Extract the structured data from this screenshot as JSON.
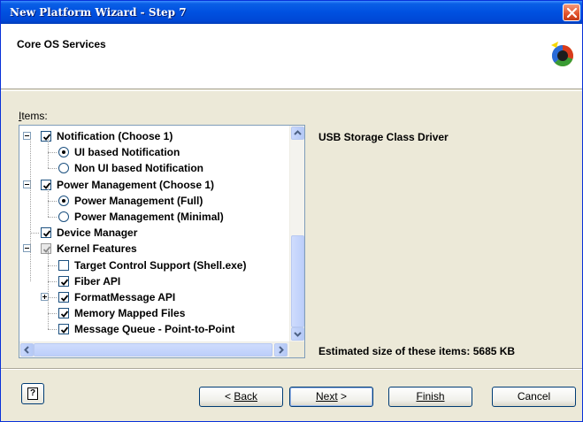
{
  "window": {
    "title": "New Platform Wizard - Step 7"
  },
  "header": {
    "page_title": "Core OS Services"
  },
  "items_label": "Items:",
  "tree": {
    "items": [
      {
        "label": "Notification (Choose 1)",
        "control": "checkbox",
        "checked": true,
        "expander": "minus"
      },
      {
        "label": "UI based Notification",
        "control": "radio",
        "selected": true
      },
      {
        "label": "Non UI based Notification",
        "control": "radio",
        "selected": false
      },
      {
        "label": "Power Management (Choose 1)",
        "control": "checkbox",
        "checked": true,
        "expander": "minus"
      },
      {
        "label": "Power Management (Full)",
        "control": "radio",
        "selected": true
      },
      {
        "label": "Power Management (Minimal)",
        "control": "radio",
        "selected": false
      },
      {
        "label": "Device Manager",
        "control": "checkbox",
        "checked": true
      },
      {
        "label": "Kernel Features",
        "control": "checkbox",
        "checked": true,
        "greyed": true,
        "expander": "minus"
      },
      {
        "label": "Target Control Support (Shell.exe)",
        "control": "checkbox",
        "checked": false
      },
      {
        "label": "Fiber API",
        "control": "checkbox",
        "checked": true
      },
      {
        "label": "FormatMessage API",
        "control": "checkbox",
        "checked": true,
        "expander": "plus"
      },
      {
        "label": "Memory Mapped Files",
        "control": "checkbox",
        "checked": true
      },
      {
        "label": "Message Queue - Point-to-Point",
        "control": "checkbox",
        "checked": true
      }
    ]
  },
  "details": {
    "selected_item": "USB Storage Class Driver",
    "estimate_text": "Estimated size of these items: 5685 KB"
  },
  "buttons": {
    "back_label": "Back",
    "next_label": "Next",
    "finish_label": "Finish",
    "cancel_label": "Cancel"
  },
  "icons": {
    "help": "help-icon",
    "close": "close-icon",
    "logo": "platform-logo-icon"
  },
  "colors": {
    "titlebar": "#0050e0",
    "dialog_bg": "#ece9d8",
    "close_button": "#e2512a",
    "control_border": "#1c5180"
  }
}
